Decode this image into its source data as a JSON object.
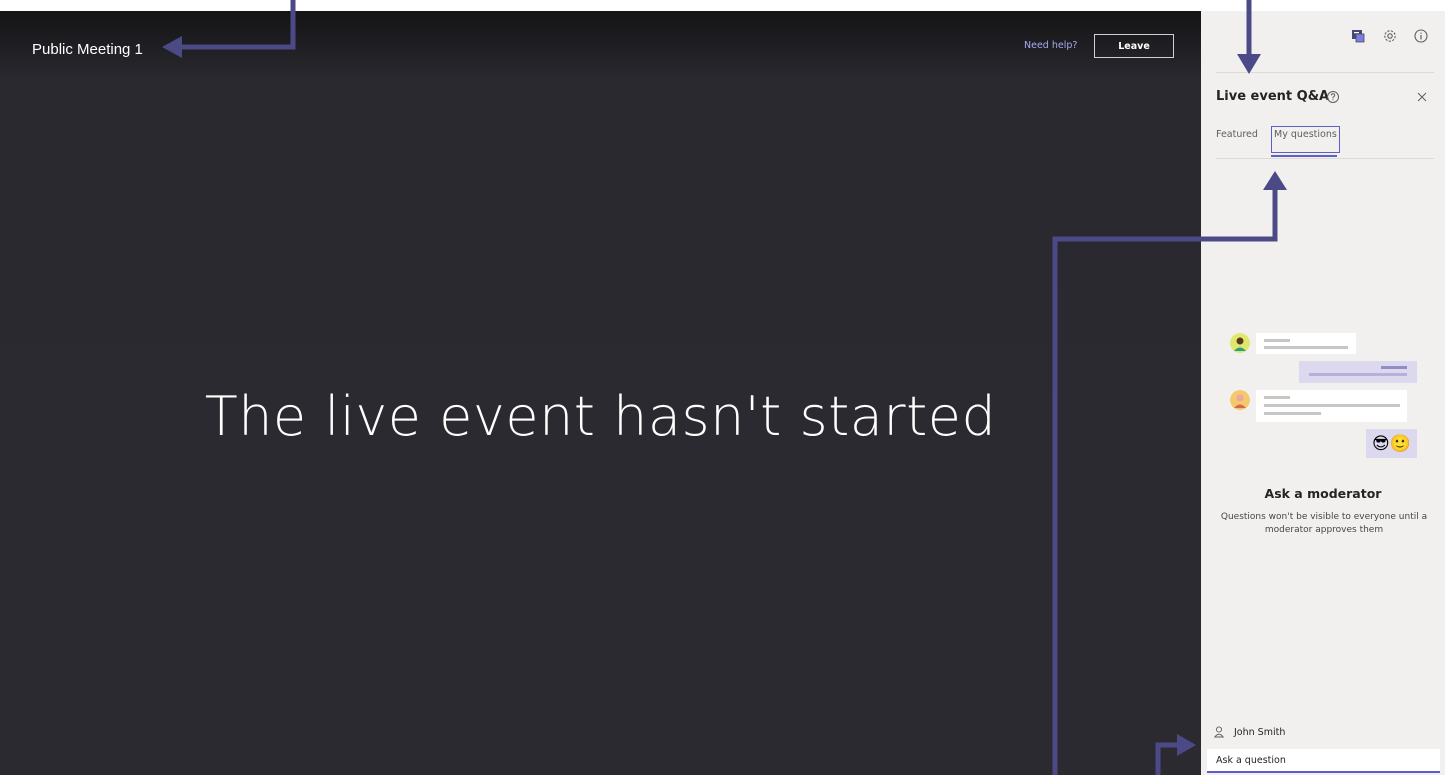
{
  "header": {
    "meeting_title": "Public Meeting 1",
    "need_help": "Need help?",
    "leave": "Leave"
  },
  "stage": {
    "headline": "The live event hasn't started"
  },
  "panel": {
    "icons": [
      "qa-icon",
      "gear-icon",
      "info-icon"
    ],
    "title": "Live event Q&A",
    "tabs": [
      {
        "label": "Featured",
        "active": false
      },
      {
        "label": "My questions",
        "active": true
      }
    ],
    "illustration_emoji": "😎🙂",
    "empty_title": "Ask a moderator",
    "empty_subtitle": "Questions won't be visible to everyone until a moderator approves them",
    "user_name": "John Smith",
    "input_placeholder": "Ask a question"
  },
  "colors": {
    "accent": "#5b5fc7",
    "annotation": "#4b4a87",
    "stage_bg": "#2b2a30",
    "panel_bg": "#f1f0ee"
  }
}
